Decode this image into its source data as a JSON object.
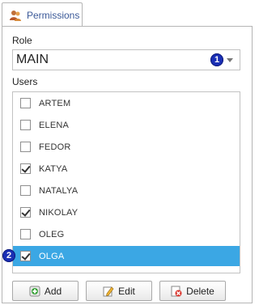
{
  "tab": {
    "label": "Permissions",
    "icon": "users-icon"
  },
  "role": {
    "label": "Role",
    "value": "MAIN",
    "badge": "1"
  },
  "users": {
    "label": "Users",
    "badge": "2",
    "items": [
      {
        "name": "ARTEM",
        "checked": false,
        "selected": false
      },
      {
        "name": "ELENA",
        "checked": false,
        "selected": false
      },
      {
        "name": "FEDOR",
        "checked": false,
        "selected": false
      },
      {
        "name": "KATYA",
        "checked": true,
        "selected": false
      },
      {
        "name": "NATALYA",
        "checked": false,
        "selected": false
      },
      {
        "name": "NIKOLAY",
        "checked": true,
        "selected": false
      },
      {
        "name": "OLEG",
        "checked": false,
        "selected": false
      },
      {
        "name": "OLGA",
        "checked": true,
        "selected": true
      }
    ]
  },
  "buttons": {
    "add": "Add",
    "edit": "Edit",
    "delete": "Delete"
  },
  "colors": {
    "selection": "#3ba7e4",
    "badge": "#1a2fb5"
  }
}
